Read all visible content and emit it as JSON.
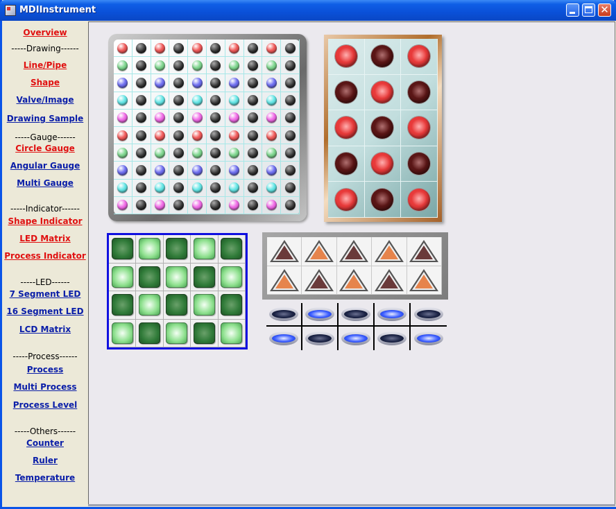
{
  "window": {
    "title": "MDIInstrument",
    "controls": {
      "minimize": "minimize-icon",
      "maximize": "maximize-icon",
      "close": "✕"
    }
  },
  "sidebar": {
    "items": [
      {
        "type": "link",
        "label": "Overview",
        "color": "red",
        "name": "sidebar-link-overview"
      },
      {
        "type": "sep",
        "label": "-----Drawing------",
        "name": "section-drawing"
      },
      {
        "type": "link",
        "label": "Line/Pipe",
        "color": "red",
        "name": "sidebar-link-line-pipe"
      },
      {
        "type": "link",
        "label": "Shape",
        "color": "red",
        "name": "sidebar-link-shape"
      },
      {
        "type": "link",
        "label": "Valve/Image",
        "color": "blue",
        "name": "sidebar-link-valve-image"
      },
      {
        "type": "link",
        "label": "Drawing Sample",
        "color": "blue",
        "name": "sidebar-link-drawing-sample"
      },
      {
        "type": "sep",
        "label": "-----Gauge------",
        "name": "section-gauge"
      },
      {
        "type": "link",
        "label": "Circle Gauge",
        "color": "red",
        "name": "sidebar-link-circle-gauge"
      },
      {
        "type": "link",
        "label": "Angular Gauge",
        "color": "blue",
        "name": "sidebar-link-angular-gauge"
      },
      {
        "type": "link",
        "label": "Multi Gauge",
        "color": "blue",
        "name": "sidebar-link-multi-gauge"
      },
      {
        "type": "sep",
        "label": "-----Indicator------",
        "name": "section-indicator"
      },
      {
        "type": "link",
        "label": "Shape Indicator",
        "color": "red",
        "name": "sidebar-link-shape-indicator"
      },
      {
        "type": "link",
        "label": "LED Matrix",
        "color": "red",
        "name": "sidebar-link-led-matrix"
      },
      {
        "type": "link",
        "label": "Process Indicator",
        "color": "red",
        "name": "sidebar-link-process-indicator"
      },
      {
        "type": "sep",
        "label": "-----LED------",
        "name": "section-led"
      },
      {
        "type": "link",
        "label": "7  Segment LED",
        "color": "blue",
        "name": "sidebar-link-7-segment-led"
      },
      {
        "type": "link",
        "label": "16 Segment LED",
        "color": "blue",
        "name": "sidebar-link-16-segment-led"
      },
      {
        "type": "link",
        "label": "LCD Matrix",
        "color": "blue",
        "name": "sidebar-link-lcd-matrix"
      },
      {
        "type": "sep",
        "label": "-----Process------",
        "name": "section-process"
      },
      {
        "type": "link",
        "label": "Process",
        "color": "blue",
        "name": "sidebar-link-process"
      },
      {
        "type": "link",
        "label": "Multi Process",
        "color": "blue",
        "name": "sidebar-link-multi-process"
      },
      {
        "type": "link",
        "label": "Process Level",
        "color": "blue",
        "name": "sidebar-link-process-level"
      },
      {
        "type": "sep",
        "label": "-----Others------",
        "name": "section-others"
      },
      {
        "type": "link",
        "label": "Counter",
        "color": "blue",
        "name": "sidebar-link-counter"
      },
      {
        "type": "link",
        "label": "Ruler",
        "color": "blue",
        "name": "sidebar-link-ruler"
      },
      {
        "type": "link",
        "label": "Temperature",
        "color": "blue",
        "name": "sidebar-link-temperature"
      }
    ]
  },
  "colors": {
    "link_red": "#e01010",
    "link_blue": "#0a1ea8",
    "titlebar": "#0a50d8",
    "led_off": "#3a3a3a",
    "led_red": "#f05a5a",
    "led_green": "#7fd68f",
    "led_blue": "#6f6ff0",
    "led_cyan": "#64e6e6",
    "led_magenta": "#f06ae6",
    "ball_on": "#e83a3a",
    "ball_off": "#5a1616",
    "square_on": "#8ee08e",
    "square_off": "#2f7a38",
    "tri_on": "#e6844c",
    "tri_off": "#6a3a3a",
    "oval_on": "#3a5cff",
    "oval_off": "#1c2446"
  },
  "indicators": {
    "led_matrix": {
      "row_colors": [
        "red",
        "green",
        "blue",
        "cyan",
        "magenta",
        "red",
        "green",
        "blue",
        "cyan",
        "magenta"
      ],
      "lit_columns": [
        0,
        2,
        4,
        6,
        8
      ]
    },
    "ball_matrix": {
      "rows": [
        [
          "on",
          "off",
          "on"
        ],
        [
          "off",
          "on",
          "off"
        ],
        [
          "on",
          "off",
          "on"
        ],
        [
          "off",
          "on",
          "off"
        ],
        [
          "on",
          "off",
          "on"
        ]
      ]
    },
    "square_matrix": {
      "rows": [
        [
          "off",
          "on",
          "off",
          "on",
          "off"
        ],
        [
          "on",
          "off",
          "on",
          "off",
          "on"
        ],
        [
          "off",
          "on",
          "off",
          "on",
          "off"
        ],
        [
          "on",
          "off",
          "on",
          "off",
          "on"
        ]
      ]
    },
    "triangle_matrix": {
      "rows": [
        [
          "off",
          "on",
          "off",
          "on",
          "off"
        ],
        [
          "on",
          "off",
          "on",
          "off",
          "on"
        ]
      ]
    },
    "oval_matrix": {
      "rows": [
        [
          "off",
          "on",
          "off",
          "on",
          "off"
        ],
        [
          "on",
          "off",
          "on",
          "off",
          "on"
        ]
      ]
    }
  }
}
